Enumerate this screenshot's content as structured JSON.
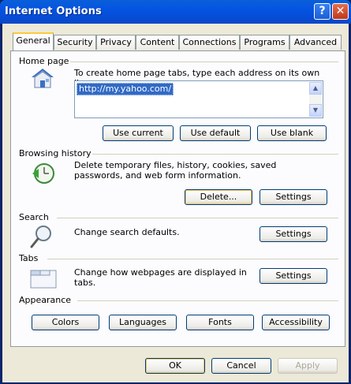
{
  "window": {
    "title": "Internet Options",
    "help_glyph": "?",
    "close_glyph": "✕"
  },
  "tabs": [
    "General",
    "Security",
    "Privacy",
    "Content",
    "Connections",
    "Programs",
    "Advanced"
  ],
  "home_page": {
    "group_label": "Home page",
    "instruction": "To create home page tabs, type each address on its own line.",
    "url": "http://my.yahoo.com/",
    "btn_current": "Use current",
    "btn_default": "Use default",
    "btn_blank": "Use blank"
  },
  "browsing_history": {
    "group_label": "Browsing history",
    "description": "Delete temporary files, history, cookies, saved passwords, and web form information.",
    "btn_delete": "Delete...",
    "btn_settings": "Settings"
  },
  "search": {
    "group_label": "Search",
    "description": "Change search defaults.",
    "btn_settings": "Settings"
  },
  "tabs_group": {
    "group_label": "Tabs",
    "description": "Change how webpages are displayed in tabs.",
    "btn_settings": "Settings"
  },
  "appearance": {
    "group_label": "Appearance",
    "btn_colors": "Colors",
    "btn_languages": "Languages",
    "btn_fonts": "Fonts",
    "btn_accessibility": "Accessibility"
  },
  "footer": {
    "ok": "OK",
    "cancel": "Cancel",
    "apply": "Apply"
  },
  "icons": {
    "home": "house-icon",
    "history": "clock-arrow-icon",
    "search": "magnifier-icon",
    "tabs": "tabs-window-icon"
  }
}
